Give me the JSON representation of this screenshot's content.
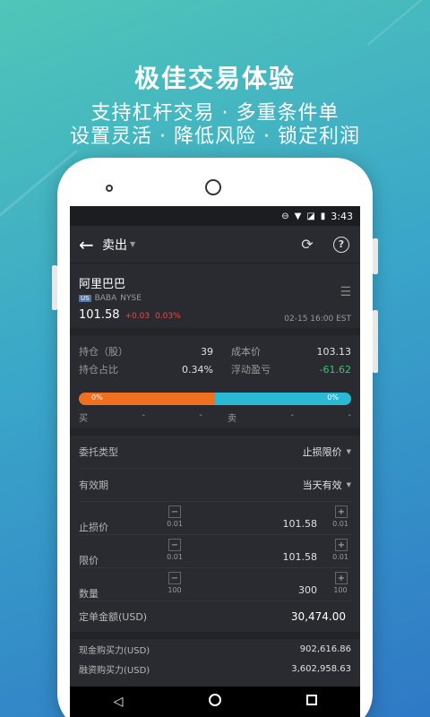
{
  "hero": {
    "title": "极佳交易体验",
    "line1": "支持杠杆交易 · 多重条件单",
    "line2": "设置灵活 · 降低风险 · 锁定利润"
  },
  "status_bar": {
    "time": "3:43"
  },
  "toolbar": {
    "back_icon": "arrow-left-icon",
    "title": "卖出",
    "refresh_icon": "refresh-icon",
    "help_icon": "help-icon",
    "help_glyph": "?"
  },
  "stock": {
    "name": "阿里巴巴",
    "market_flag": "US",
    "symbol": "BABA",
    "exchange": "NYSE",
    "price": "101.58",
    "change": "+0.03",
    "change_pct": "0.03%",
    "time": "02-15 16:00 EST"
  },
  "position": {
    "hold_label": "持仓（股）",
    "hold_value": "39",
    "cost_label": "成本价",
    "cost_value": "103.13",
    "ratio_label": "持仓占比",
    "ratio_value": "0.34%",
    "pl_label": "浮动盈亏",
    "pl_value": "-61.62"
  },
  "book": {
    "buy_pct_label": "0%",
    "sell_pct_label": "0%",
    "buy_fraction": 0.5,
    "buy_label": "买",
    "sell_label": "卖",
    "dash": "-"
  },
  "form": {
    "order_type_label": "委托类型",
    "order_type_value": "止损限价",
    "validity_label": "有效期",
    "validity_value": "当天有效",
    "stop_label": "止损价",
    "stop_value": "101.58",
    "stop_step": "0.01",
    "limit_label": "限价",
    "limit_value": "101.58",
    "limit_step": "0.01",
    "qty_label": "数量",
    "qty_value": "300",
    "qty_step": "100",
    "minus": "−",
    "plus": "+",
    "amount_label": "定单金额(USD)",
    "amount_value": "30,474.00"
  },
  "buying_power": {
    "cash_label": "现金购买力(USD)",
    "cash_value": "902,616.86",
    "margin_label": "融资购买力(USD)",
    "margin_value": "3,602,958.63"
  },
  "colors": {
    "buy_bar": "#f07020",
    "sell_bar": "#2bbad6",
    "down": "#3cc36a",
    "up": "#e84a4a"
  }
}
